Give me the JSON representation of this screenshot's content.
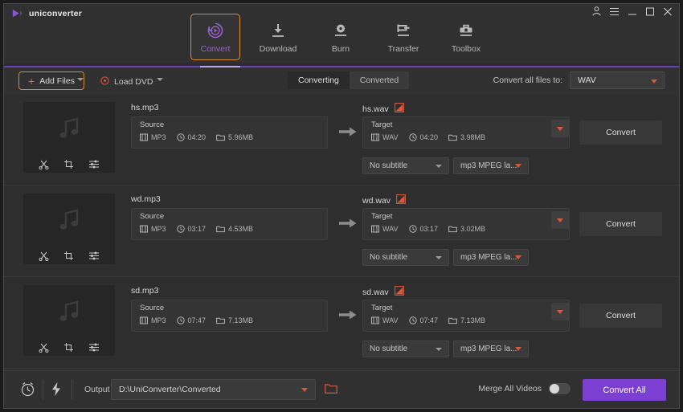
{
  "window": {
    "brand": "uniconverter",
    "controls": [
      {
        "name": "account-icon",
        "label": "account"
      },
      {
        "name": "menu-icon",
        "label": "menu"
      },
      {
        "name": "minimize-button",
        "label": "minimize"
      },
      {
        "name": "maximize-button",
        "label": "maximize"
      },
      {
        "name": "close-button",
        "label": "close"
      }
    ]
  },
  "nav": {
    "tabs": [
      {
        "label": "Convert",
        "icon": "convert-icon",
        "active": true
      },
      {
        "label": "Download",
        "icon": "download-icon",
        "active": false
      },
      {
        "label": "Burn",
        "icon": "burn-icon",
        "active": false
      },
      {
        "label": "Transfer",
        "icon": "transfer-icon",
        "active": false
      },
      {
        "label": "Toolbox",
        "icon": "toolbox-icon",
        "active": false
      }
    ]
  },
  "actionbar": {
    "add_files": "Add Files",
    "load_dvd": "Load DVD",
    "tabs": [
      {
        "label": "Converting",
        "active": true
      },
      {
        "label": "Converted",
        "active": false
      }
    ],
    "convert_all_to_label": "Convert all files to:",
    "convert_all_to_value": "WAV"
  },
  "files": [
    {
      "source_name": "hs.mp3",
      "target_name": "hs.wav",
      "source": {
        "caption": "Source",
        "format": "MP3",
        "duration": "04:20",
        "size": "5.96MB"
      },
      "target": {
        "caption": "Target",
        "format": "WAV",
        "duration": "04:20",
        "size": "3.98MB"
      },
      "subtitle": "No subtitle",
      "codec": "mp3 MPEG la...",
      "convert_label": "Convert"
    },
    {
      "source_name": "wd.mp3",
      "target_name": "wd.wav",
      "source": {
        "caption": "Source",
        "format": "MP3",
        "duration": "03:17",
        "size": "4.53MB"
      },
      "target": {
        "caption": "Target",
        "format": "WAV",
        "duration": "03:17",
        "size": "3.02MB"
      },
      "subtitle": "No subtitle",
      "codec": "mp3 MPEG la...",
      "convert_label": "Convert"
    },
    {
      "source_name": "sd.mp3",
      "target_name": "sd.wav",
      "source": {
        "caption": "Source",
        "format": "MP3",
        "duration": "07:47",
        "size": "7.13MB"
      },
      "target": {
        "caption": "Target",
        "format": "WAV",
        "duration": "07:47",
        "size": "7.13MB"
      },
      "subtitle": "No subtitle",
      "codec": "mp3 MPEG la...",
      "convert_label": "Convert"
    }
  ],
  "bottombar": {
    "output_label": "Output",
    "output_path": "D:\\UniConverter\\Converted",
    "merge_label": "Merge All Videos",
    "merge_enabled": false,
    "convert_all_label": "Convert All"
  },
  "colors": {
    "accent_purple": "#7b3fd1",
    "accent_orange": "#e08a2e",
    "accent_red": "#d9593c",
    "window_bg": "#2b2b2b",
    "panel_bg": "#2e2e2e"
  }
}
